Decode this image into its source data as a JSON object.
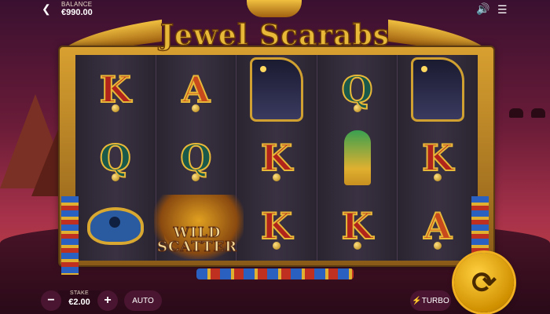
{
  "game": {
    "title": "Jewel Scarabs"
  },
  "topbar": {
    "balance_label": "BALANCE",
    "balance_value": "€990.00"
  },
  "reels": [
    [
      "K",
      "Q",
      "eye-of-horus"
    ],
    [
      "A",
      "Q",
      "scarab-wild"
    ],
    [
      "anubis",
      "K",
      "K"
    ],
    [
      "Q",
      "falcon",
      "K"
    ],
    [
      "anubis",
      "K",
      "A"
    ]
  ],
  "wild_scatter": {
    "line1": "WILD",
    "line2": "SCATTER"
  },
  "controls": {
    "stake_label": "STAKE",
    "stake_value": "€2.00",
    "minus_label": "−",
    "plus_label": "+",
    "auto_label": "AUTO",
    "turbo_label": "TURBO"
  },
  "colors": {
    "accent_gold": "#e8b838",
    "king_red": "#b0241c",
    "button_bg": "#4a1530"
  }
}
